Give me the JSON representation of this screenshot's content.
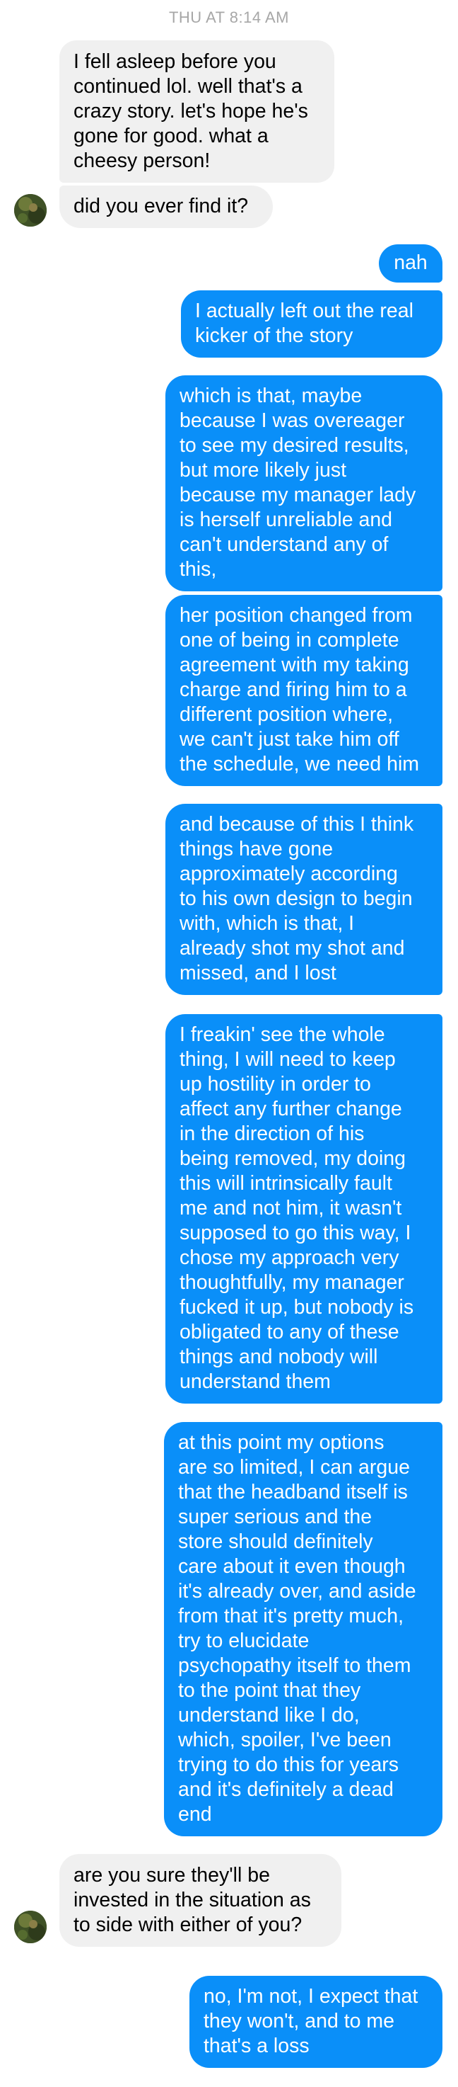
{
  "conversation": {
    "timestamp": "THU AT 8:14 AM",
    "colors": {
      "incoming_bubble": "#f0f0f0",
      "outgoing_bubble": "#0a8ff9",
      "timestamp_text": "#a7a7a7"
    },
    "messages": [
      {
        "sender": "them",
        "text": "I fell asleep before you\ncontinued lol. well that's a\ncrazy story. let's hope he's\ngone for good. what a\ncheesy person!"
      },
      {
        "sender": "them",
        "text": "did you ever find it?"
      },
      {
        "sender": "me",
        "text": "nah"
      },
      {
        "sender": "me",
        "text": "I actually left out the real\nkicker of the story"
      },
      {
        "sender": "me",
        "text": "which is that, maybe\nbecause I was overeager\nto see my desired results,\nbut more likely just\nbecause my manager lady\nis herself unreliable and\ncan't understand any of\nthis,"
      },
      {
        "sender": "me",
        "text": "her position changed from\none of being in complete\nagreement with my taking\ncharge and firing him to a\ndifferent position where,\nwe can't just take him off\nthe schedule, we need him"
      },
      {
        "sender": "me",
        "text": "and because of this I think\nthings have gone\napproximately according\nto his own design to begin\nwith, which is that, I\nalready shot my shot and\nmissed, and I lost"
      },
      {
        "sender": "me",
        "text": "I freakin' see the whole\nthing, I will need to keep\nup hostility in order to\naffect any further change\nin the direction of his\nbeing removed, my doing\nthis will intrinsically fault\nme and not him, it wasn't\nsupposed to go this way, I\nchose my approach very\nthoughtfully, my manager\nfucked it up, but nobody is\nobligated to any of these\nthings and nobody will\nunderstand them"
      },
      {
        "sender": "me",
        "text": "at this point my options\nare so limited, I can argue\nthat the headband itself is\nsuper serious and the\nstore should definitely\ncare about it even though\nit's already over, and aside\nfrom that it's pretty much,\ntry to elucidate\npsychopathy itself to them\nto the point that they\nunderstand like I do,\nwhich, spoiler, I've been\ntrying to do this for years\nand it's definitely a dead\nend"
      },
      {
        "sender": "them",
        "text": "are you sure they'll be\ninvested in the situation as\nto side with either of you?"
      },
      {
        "sender": "me",
        "text": "no, I'm not, I expect that\nthey won't, and to me\nthat's a loss"
      }
    ]
  }
}
